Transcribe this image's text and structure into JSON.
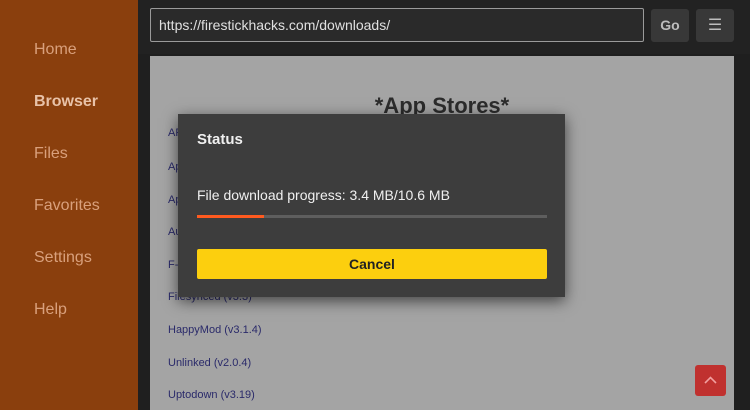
{
  "sidebar": {
    "items": [
      {
        "label": "Home",
        "active": false
      },
      {
        "label": "Browser",
        "active": true
      },
      {
        "label": "Files",
        "active": false
      },
      {
        "label": "Favorites",
        "active": false
      },
      {
        "label": "Settings",
        "active": false
      },
      {
        "label": "Help",
        "active": false
      }
    ]
  },
  "toolbar": {
    "url": "https://firestickhacks.com/downloads/",
    "go_label": "Go",
    "menu_icon": "hamburger-menu-icon"
  },
  "webpage": {
    "title": "*App Stores*",
    "partial_links": [
      "AP",
      "Ap",
      "Ap",
      "Au",
      "F-"
    ],
    "links": [
      "Filesynced (v3.3)",
      "HappyMod (v3.1.4)",
      "Unlinked (v2.0.4)",
      "Uptodown (v3.19)"
    ]
  },
  "dialog": {
    "title": "Status",
    "progress_text": "File download progress: 3.4 MB/10.6 MB",
    "progress_fraction": 0.19,
    "cancel_label": "Cancel"
  },
  "fab": {
    "icon": "chevron-up-icon"
  },
  "colors": {
    "sidebar_bg": "#8a3f0d",
    "progress_accent": "#ff5a1f",
    "cancel_button": "#fccf0e",
    "fab": "#c0312f"
  }
}
